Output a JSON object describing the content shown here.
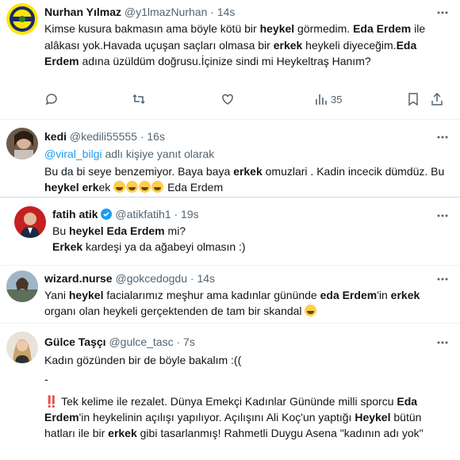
{
  "colors": {
    "text": "#0f1419",
    "muted": "#536471",
    "link": "#1d9bf0",
    "divider": "#eff3f4"
  },
  "tweets": [
    {
      "name": "Nurhan Yılmaz",
      "handle": "@y1lmazNurhan",
      "time": "· 14s",
      "segments": [
        {
          "t": "Kimse kusura bakmasın ama böyle kötü bir "
        },
        {
          "t": "heykel",
          "b": true
        },
        {
          "t": " görmedim. "
        },
        {
          "t": "Eda Erdem",
          "b": true
        },
        {
          "t": " ile alâkası yok.Havada uçuşan saçları olmasa bir "
        },
        {
          "t": "erkek",
          "b": true
        },
        {
          "t": " heykeli diyeceğim."
        },
        {
          "t": "Eda Erdem",
          "b": true
        },
        {
          "t": " adına üzüldüm doğrusu.İçinize sindi mi Heykeltraş Hanım?"
        }
      ],
      "views": "35",
      "icons": [
        "reply-icon",
        "retweet-icon",
        "like-icon",
        "views-icon",
        "bookmark-icon",
        "share-icon"
      ]
    },
    {
      "name": "kedi",
      "handle": "@kedili55555",
      "time": "· 16s",
      "reply_to_handle": "@viral_bilgi",
      "reply_to_suffix": " adlı kişiye yanıt olarak",
      "segments": [
        {
          "t": "Bu da bi seye benzemiyor. Baya baya "
        },
        {
          "t": "erkek",
          "b": true
        },
        {
          "t": " omuzlari . Kadin incecik dümdüz.  Bu "
        },
        {
          "t": "heykel",
          "b": true
        },
        {
          "t": " "
        },
        {
          "t": "erk",
          "b": true
        },
        {
          "t": "ek "
        }
      ],
      "trailing_text": " Eda Erdem",
      "emoji_name": "face-with-tears-of-joy",
      "emoji_count": 4
    },
    {
      "name": "fatih atik",
      "handle": "@atikfatih1",
      "time": "· 19s",
      "line1": [
        {
          "t": "Bu "
        },
        {
          "t": "heykel Eda Erdem",
          "b": true
        },
        {
          "t": " mi?"
        }
      ],
      "line2": [
        {
          "t": "Erkek",
          "b": true
        },
        {
          "t": " kardeşi ya da ağabeyi olmasın :)"
        }
      ]
    },
    {
      "name": "wizard.nurse",
      "handle": "@gokcedogdu",
      "time": "· 14s",
      "segments": [
        {
          "t": "Yani "
        },
        {
          "t": "heykel",
          "b": true
        },
        {
          "t": " facialarımız meşhur ama kadınlar gününde "
        },
        {
          "t": "eda Erdem",
          "b": true
        },
        {
          "t": "'in "
        },
        {
          "t": "erkek",
          "b": true
        },
        {
          "t": " organı olan heykeli gerçektenden de tam bir skandal "
        }
      ],
      "emoji_name": "relieved-face"
    },
    {
      "name": "Gülce Taşçı",
      "handle": "@gulce_tasc",
      "time": "· 7s",
      "line1": "Kadın gözünden bir de böyle bakalım :((",
      "line2": "-",
      "bang": "‼️",
      "segments": [
        {
          "t": " Tek kelime ile rezalet. Dünya Emekçi Kadınlar Gününde milli sporcu "
        },
        {
          "t": "Eda Erdem",
          "b": true
        },
        {
          "t": "'in heykelinin açılışı yapılıyor. Açılışını Ali Koç'un yaptığı "
        },
        {
          "t": "Heykel",
          "b": true
        },
        {
          "t": " bütün hatları ile bir "
        },
        {
          "t": "erkek",
          "b": true
        },
        {
          "t": " gibi tasarlanmış!  Rahmetli Duygu Asena \"kadının adı yok\""
        }
      ]
    }
  ]
}
